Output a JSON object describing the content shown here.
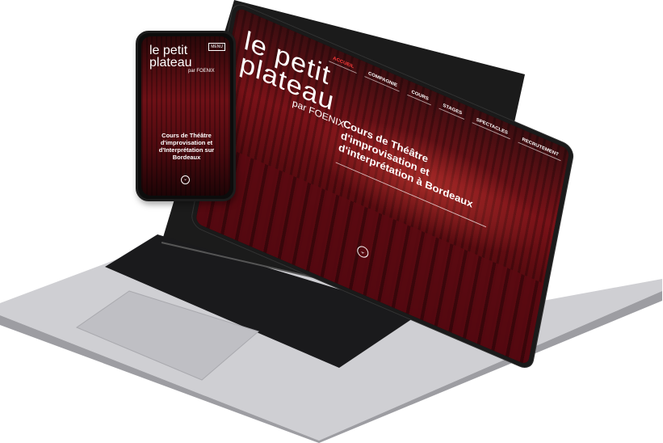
{
  "site": {
    "logo": {
      "line1": "le petit",
      "line2": "plateau",
      "tagline": "par FOENIX"
    },
    "nav": [
      {
        "label": "ACCUEIL",
        "active": true
      },
      {
        "label": "COMPAGNIE"
      },
      {
        "label": "COURS"
      },
      {
        "label": "STAGES"
      },
      {
        "label": "SPECTACLES"
      },
      {
        "label": "RECRUTEMENT"
      }
    ],
    "hero_title": "Cours de Théâtre d'improvisation et d'interprétation à Bordeaux"
  },
  "phone": {
    "logo": {
      "line1": "le petit",
      "line2": "plateau",
      "tagline": "par FOENIX"
    },
    "menu_label": "MENU",
    "hero_title": "Cours de Théâtre d'improvisation et d'Interprétation sur Bordeaux"
  },
  "colors": {
    "accent": "#ff3b3b",
    "curtain": "#7a1218",
    "laptop_body": "#c9c9cc"
  },
  "icons": {
    "scroll_down": "chevron-down-icon"
  }
}
